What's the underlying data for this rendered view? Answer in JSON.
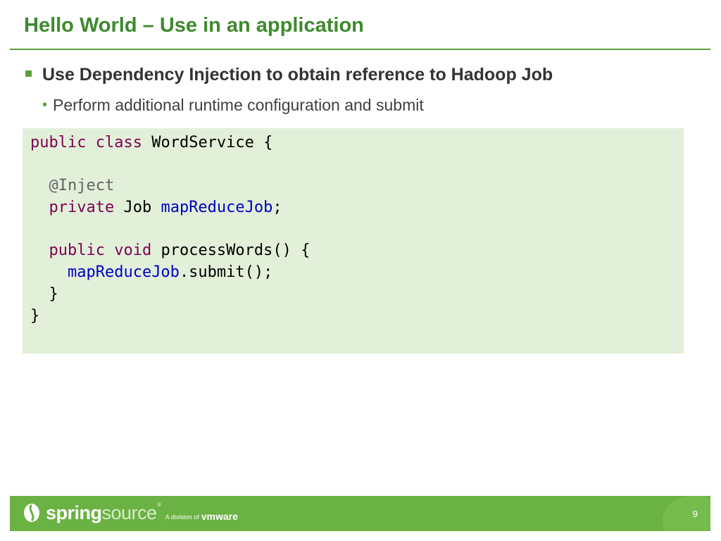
{
  "slide": {
    "title": "Hello World – Use in an application"
  },
  "bullets": {
    "level1": "Use Dependency Injection to obtain reference to Hadoop Job",
    "level2": "Perform additional runtime configuration and submit"
  },
  "code": {
    "lines": [
      [
        {
          "t": "public",
          "c": "kw"
        },
        {
          "t": " "
        },
        {
          "t": "class",
          "c": "kw"
        },
        {
          "t": " WordService {"
        }
      ],
      [],
      [
        {
          "t": "  "
        },
        {
          "t": "@Inject",
          "c": "ann"
        }
      ],
      [
        {
          "t": "  "
        },
        {
          "t": "private",
          "c": "kw"
        },
        {
          "t": " Job "
        },
        {
          "t": "mapReduceJob",
          "c": "fld"
        },
        {
          "t": ";"
        }
      ],
      [],
      [
        {
          "t": "  "
        },
        {
          "t": "public",
          "c": "kw"
        },
        {
          "t": " "
        },
        {
          "t": "void",
          "c": "kw"
        },
        {
          "t": " processWords() {"
        }
      ],
      [
        {
          "t": "    "
        },
        {
          "t": "mapReduceJob",
          "c": "fld"
        },
        {
          "t": ".submit();"
        }
      ],
      [
        {
          "t": "  }"
        }
      ],
      [
        {
          "t": "}"
        }
      ]
    ]
  },
  "footer": {
    "logo_spring": "spring",
    "logo_source": "source",
    "logo_tm": "®",
    "division_text": "A division of",
    "vmware_text": "vmware",
    "page_number": "9"
  },
  "colors": {
    "title_green": "#3d8a2e",
    "bar_green": "#6ab243",
    "code_bg": "#e2f0d9",
    "keyword": "#7f0055",
    "annotation": "#646464",
    "field": "#0000c0"
  },
  "icons": {
    "logo": "springsource-leaf-icon",
    "bullet1": "green-square-bullet-icon",
    "bullet2": "green-dot-bullet-icon"
  }
}
